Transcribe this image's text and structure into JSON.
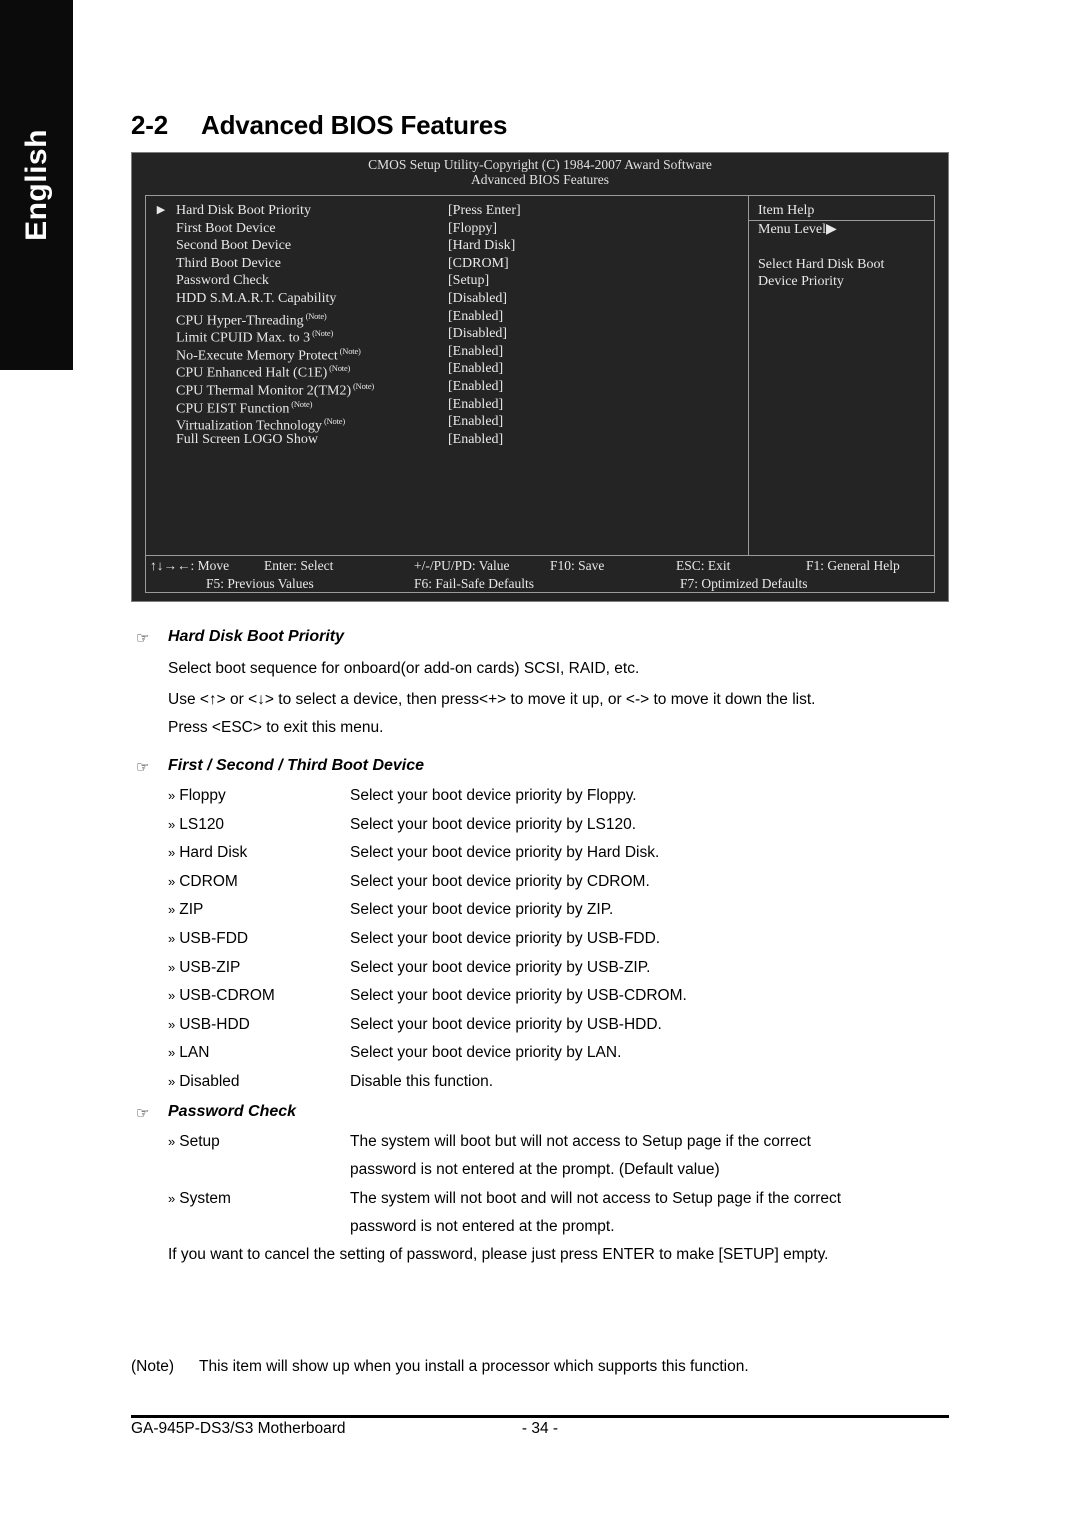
{
  "language_tab": {
    "label": "English"
  },
  "heading": {
    "number": "2-2",
    "title": "Advanced BIOS Features"
  },
  "bios": {
    "title_line1": "CMOS Setup Utility-Copyright (C) 1984-2007 Award Software",
    "title_line2": "Advanced BIOS Features",
    "submenu_arrow": "▶",
    "items": [
      {
        "arrow": "▶",
        "label": "Hard Disk Boot Priority",
        "note": "",
        "value": "[Press Enter]"
      },
      {
        "arrow": "",
        "label": "First Boot Device",
        "note": "",
        "value": "[Floppy]"
      },
      {
        "arrow": "",
        "label": "Second Boot Device",
        "note": "",
        "value": "[Hard Disk]"
      },
      {
        "arrow": "",
        "label": "Third Boot Device",
        "note": "",
        "value": "[CDROM]"
      },
      {
        "arrow": "",
        "label": "Password Check",
        "note": "",
        "value": "[Setup]"
      },
      {
        "arrow": "",
        "label": "HDD S.M.A.R.T. Capability",
        "note": "",
        "value": "[Disabled]"
      },
      {
        "arrow": "",
        "label": "CPU Hyper-Threading",
        "note": "(Note)",
        "value": "[Enabled]"
      },
      {
        "arrow": "",
        "label": "Limit CPUID Max. to 3",
        "note": "(Note)",
        "value": "[Disabled]"
      },
      {
        "arrow": "",
        "label": "No-Execute Memory Protect",
        "note": "(Note)",
        "value": "[Enabled]"
      },
      {
        "arrow": "",
        "label": "CPU Enhanced Halt (C1E)",
        "note": "(Note)",
        "value": "[Enabled]"
      },
      {
        "arrow": "",
        "label": "CPU Thermal Monitor 2(TM2)",
        "note": "(Note)",
        "value": "[Enabled]"
      },
      {
        "arrow": "",
        "label": "CPU EIST Function",
        "note": "(Note)",
        "value": "[Enabled]"
      },
      {
        "arrow": "",
        "label": "Virtualization Technology",
        "note": "(Note)",
        "value": "[Enabled]"
      },
      {
        "arrow": "",
        "label": "Full Screen LOGO Show",
        "note": "",
        "value": "[Enabled]"
      }
    ],
    "help": {
      "title": "Item Help",
      "menu_level": "Menu Level",
      "menu_level_arrow": "▶",
      "text_line1": "Select Hard Disk Boot",
      "text_line2": "Device Priority"
    },
    "footer": {
      "row1": [
        "↑↓→←: Move",
        "Enter: Select",
        "+/-/PU/PD: Value",
        "F10: Save",
        "ESC: Exit",
        "F1: General Help"
      ],
      "row2": [
        "F5: Previous Values",
        "F6: Fail-Safe Defaults",
        "F7: Optimized Defaults"
      ]
    }
  },
  "doc": {
    "hand_glyph": "☞",
    "bullet_glyph": "»",
    "sections": [
      {
        "title": "Hard Disk Boot Priority",
        "paragraphs": [
          "Select boot sequence for onboard(or add-on cards) SCSI, RAID, etc.",
          "Use <↑> or <↓> to select a device, then press<+> to move it up, or <-> to move it down the list.",
          "Press <ESC> to exit this menu."
        ]
      },
      {
        "title": "First / Second / Third Boot Device",
        "options": [
          {
            "term": "Floppy",
            "desc": "Select your boot device priority by Floppy."
          },
          {
            "term": "LS120",
            "desc": "Select your boot device priority by LS120."
          },
          {
            "term": "Hard Disk",
            "desc": "Select your boot device priority by Hard Disk."
          },
          {
            "term": "CDROM",
            "desc": "Select your boot device priority by CDROM."
          },
          {
            "term": "ZIP",
            "desc": "Select your boot device priority by ZIP."
          },
          {
            "term": "USB-FDD",
            "desc": "Select your boot device priority by USB-FDD."
          },
          {
            "term": "USB-ZIP",
            "desc": "Select your boot device priority by USB-ZIP."
          },
          {
            "term": "USB-CDROM",
            "desc": "Select your boot device priority by USB-CDROM."
          },
          {
            "term": "USB-HDD",
            "desc": "Select your boot device priority by USB-HDD."
          },
          {
            "term": "LAN",
            "desc": "Select your boot device priority by LAN."
          },
          {
            "term": "Disabled",
            "desc": "Disable this function."
          }
        ]
      },
      {
        "title": "Password Check",
        "options": [
          {
            "term": "Setup",
            "desc": "The system will boot but will not access to Setup page if the correct",
            "desc2": "password is not entered at the prompt. (Default value)"
          },
          {
            "term": "System",
            "desc": "The system will not boot and will not access to Setup page if the correct",
            "desc2": "password is not entered at the prompt."
          }
        ],
        "closing": "If you want to cancel the setting of password, please just press ENTER to make [SETUP] empty."
      }
    ]
  },
  "note": {
    "tag": "(Note)",
    "text": "This item will show up when you install a processor which supports this function."
  },
  "page_footer": {
    "left": "GA-945P-DS3/S3 Motherboard",
    "page": "- 34 -"
  }
}
